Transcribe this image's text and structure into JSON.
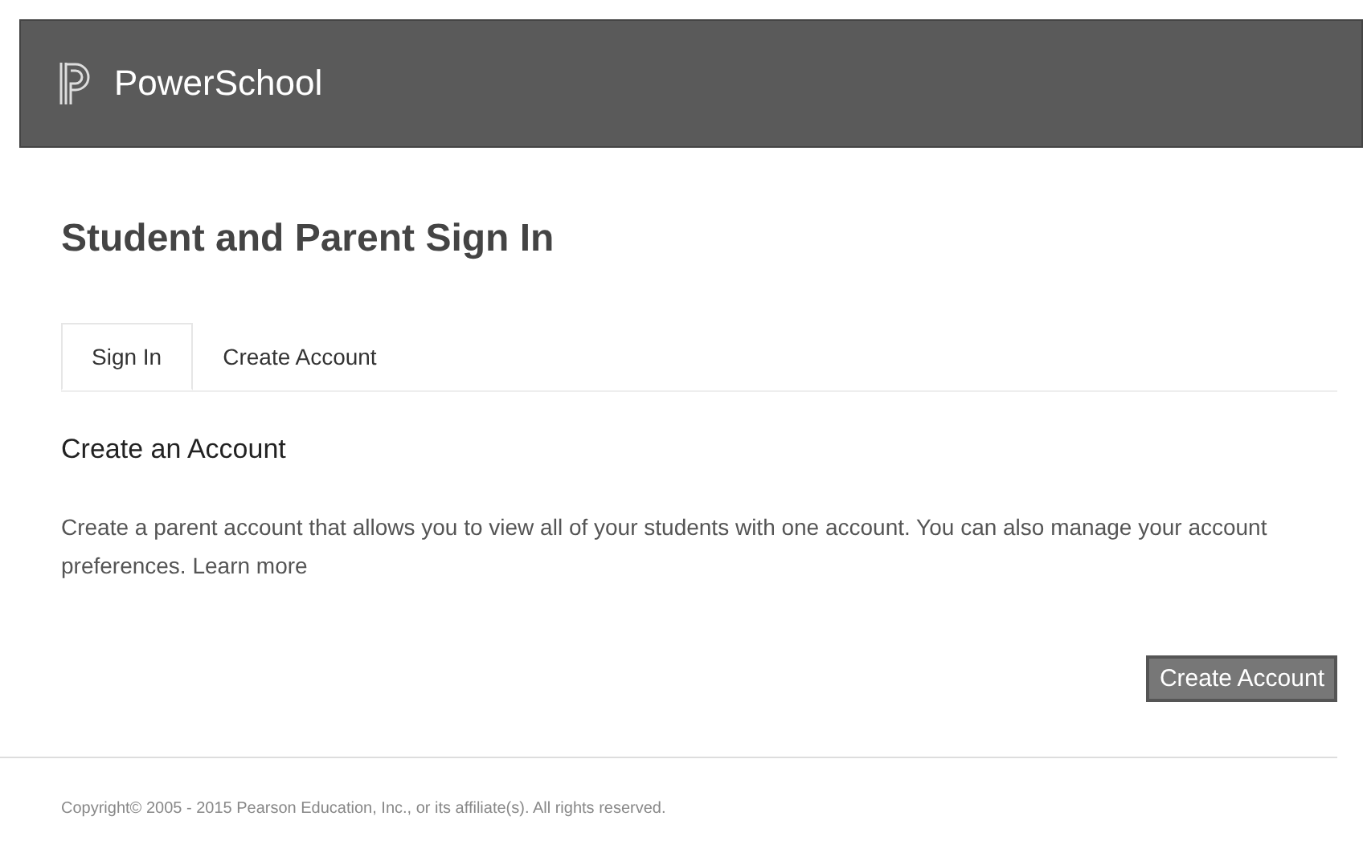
{
  "header": {
    "brand": "PowerSchool"
  },
  "page_title": "Student and Parent Sign In",
  "tabs": [
    {
      "label": "Sign In",
      "selected": true
    },
    {
      "label": "Create Account",
      "selected": false
    }
  ],
  "section": {
    "heading": "Create an Account",
    "text": "Create a parent account that allows you to view all of your students with one account. You can also manage your account preferences.",
    "link": "Learn more",
    "button": "Create Account"
  },
  "footer": {
    "copyright": "Copyright© 2005 - 2015 Pearson Education, Inc., or its affiliate(s). All rights reserved."
  }
}
